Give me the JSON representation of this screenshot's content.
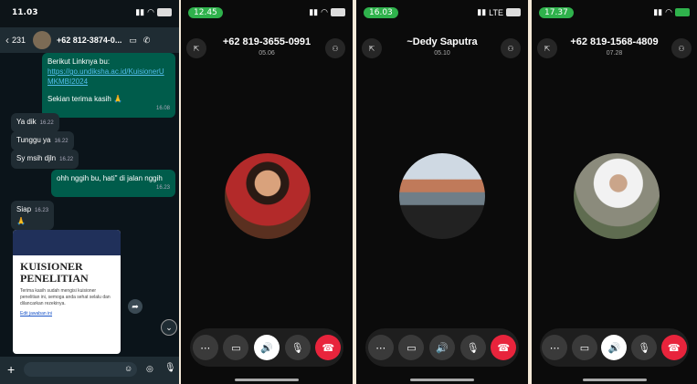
{
  "chat": {
    "status_time": "11.03",
    "back_label": "231",
    "contact": "+62 812-3874-0...",
    "messages": [
      {
        "dir": "out",
        "lines": [
          "Berikut Linknya bu:"
        ],
        "link": "https://go.undiksha.ac.id/KuisionerUMKMBI2024",
        "tail": "Sekian terima kasih 🙏",
        "time": "16.08"
      },
      {
        "dir": "in",
        "text": "Ya dik",
        "time": "16.22"
      },
      {
        "dir": "in",
        "text": "Tunggu ya",
        "time": "16.22"
      },
      {
        "dir": "in",
        "text": "Sy msih djln",
        "time": "16.22"
      },
      {
        "dir": "out",
        "text": "ohh nggih bu, hati\" di jalan nggih",
        "time": "16.23"
      },
      {
        "dir": "in",
        "text": "Siap",
        "time": "16.23"
      }
    ],
    "card": {
      "title": "KUISIONER PENELITIAN",
      "body": "Terima kasih sudah mengisi kuisioner penelitian ini, semoga anda sehat selalu dan dilancarkan rezekinya.",
      "link": "Edit jawaban ini"
    }
  },
  "calls": [
    {
      "time": "12.45",
      "name": "+62 819-3655-0991",
      "duration": "05.06",
      "network": "",
      "accent": "#2fb24c"
    },
    {
      "time": "16.03",
      "name": "~Dedy Saputra",
      "duration": "05.10",
      "network": "LTE",
      "accent": "#2fb24c"
    },
    {
      "time": "17.37",
      "name": "+62 819-1568-4809",
      "duration": "07.28",
      "network": "",
      "accent": "#2fb24c"
    }
  ],
  "icons": [
    "back-icon",
    "video-icon",
    "phone-icon",
    "more-icon",
    "camera-icon",
    "speaker-icon",
    "mic-off-icon",
    "end-call-icon",
    "add-person-icon",
    "minimize-icon",
    "plus-icon",
    "sticker-icon",
    "mic-icon",
    "forward-icon",
    "scroll-down-icon"
  ]
}
